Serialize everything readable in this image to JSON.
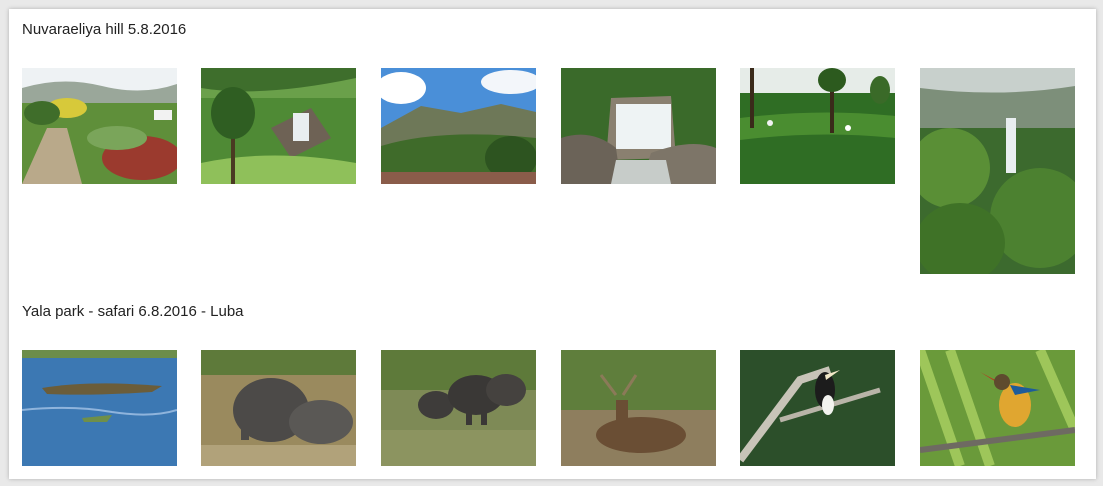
{
  "albums": [
    {
      "title": "Nuvaraeliya hill 5.8.2016",
      "photos": [
        {
          "subject": "garden-path"
        },
        {
          "subject": "waterfall-valley"
        },
        {
          "subject": "mountain-sky"
        },
        {
          "subject": "waterfall-rocks"
        },
        {
          "subject": "tea-plantation"
        },
        {
          "subject": "tall-waterfall-forest"
        }
      ]
    },
    {
      "title": "Yala park - safari 6.8.2016 - Luba",
      "photos": [
        {
          "subject": "crocodile-lake"
        },
        {
          "subject": "elephants-bathing"
        },
        {
          "subject": "elephant-herd"
        },
        {
          "subject": "deer-pond"
        },
        {
          "subject": "hornbill-branch"
        },
        {
          "subject": "kingfisher-branch"
        }
      ]
    }
  ]
}
